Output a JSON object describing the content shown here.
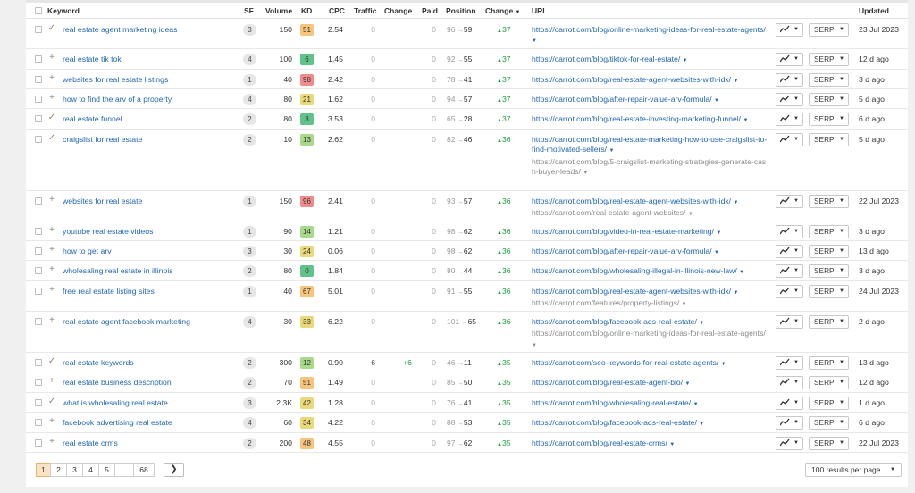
{
  "columns": {
    "keyword": "Keyword",
    "sf": "SF",
    "volume": "Volume",
    "kd": "KD",
    "cpc": "CPC",
    "traffic": "Traffic",
    "change": "Change",
    "paid": "Paid",
    "position": "Position",
    "position_change": "Change",
    "url": "URL",
    "updated": "Updated"
  },
  "sort_indicator": "▼",
  "dropdown_glyph": "▼",
  "up_glyph": "▲",
  "arrow_glyph": "→",
  "chart_button_icon": "chart-line-icon",
  "serp_label": "SERP",
  "kd_colors": {
    "very_hard": "#f08c8c",
    "hard": "#f6c47a",
    "medium": "#e9d97a",
    "easy": "#a9d98b",
    "very_easy": "#5fc38a"
  },
  "rows": [
    {
      "icon": "check",
      "keyword": "real estate agent marketing ideas",
      "sf": "3",
      "volume": "150",
      "kd": "51",
      "kd_level": "hard",
      "cpc": "2.54",
      "traffic": "0",
      "traffic_change": "",
      "paid": "0",
      "pos_from": "96",
      "pos_to": "59",
      "change": "37",
      "urls": [
        {
          "text": "https://carrot.com/blog/online-marketing-ideas-for-real-estate-agents/",
          "struck": false
        }
      ],
      "updated": "23 Jul 2023"
    },
    {
      "icon": "plus",
      "keyword": "real estate tik tok",
      "sf": "4",
      "volume": "100",
      "kd": "6",
      "kd_level": "very_easy",
      "cpc": "1.45",
      "traffic": "0",
      "traffic_change": "",
      "paid": "0",
      "pos_from": "92",
      "pos_to": "55",
      "change": "37",
      "urls": [
        {
          "text": "https://carrot.com/blog/tiktok-for-real-estate/",
          "struck": false
        }
      ],
      "updated": "12 d ago"
    },
    {
      "icon": "plus",
      "keyword": "websites for real estate listings",
      "sf": "1",
      "volume": "40",
      "kd": "98",
      "kd_level": "very_hard",
      "cpc": "2.42",
      "traffic": "0",
      "traffic_change": "",
      "paid": "0",
      "pos_from": "78",
      "pos_to": "41",
      "change": "37",
      "urls": [
        {
          "text": "https://carrot.com/blog/real-estate-agent-websites-with-idx/",
          "struck": false
        }
      ],
      "updated": "3 d ago"
    },
    {
      "icon": "plus",
      "keyword": "how to find the arv of a property",
      "sf": "4",
      "volume": "80",
      "kd": "21",
      "kd_level": "medium",
      "cpc": "1.62",
      "traffic": "0",
      "traffic_change": "",
      "paid": "0",
      "pos_from": "94",
      "pos_to": "57",
      "change": "37",
      "urls": [
        {
          "text": "https://carrot.com/blog/after-repair-value-arv-formula/",
          "struck": false
        }
      ],
      "updated": "5 d ago"
    },
    {
      "icon": "check",
      "keyword": "real estate funnel",
      "sf": "2",
      "volume": "80",
      "kd": "3",
      "kd_level": "very_easy",
      "cpc": "3.53",
      "traffic": "0",
      "traffic_change": "",
      "paid": "0",
      "pos_from": "65",
      "pos_to": "28",
      "change": "37",
      "urls": [
        {
          "text": "https://carrot.com/blog/real-estate-investing-marketing-funnel/",
          "struck": false
        }
      ],
      "updated": "6 d ago"
    },
    {
      "icon": "check",
      "keyword": "craigslist for real estate",
      "sf": "2",
      "volume": "10",
      "kd": "13",
      "kd_level": "easy",
      "cpc": "2.62",
      "traffic": "0",
      "traffic_change": "",
      "paid": "0",
      "pos_from": "82",
      "pos_to": "46",
      "change": "36",
      "urls": [
        {
          "text": "https://carrot.com/blog/real-estate-marketing-how-to-use-craigslist-to-find-motivated-sellers/",
          "struck": false
        },
        {
          "text": "https://carrot.com/blog/5-craigslist-marketing-strategies-generate-cash-buyer-leads/",
          "struck": true
        }
      ],
      "updated": "5 d ago"
    },
    {
      "icon": "plus",
      "keyword": "websites for real estate",
      "sf": "1",
      "volume": "150",
      "kd": "96",
      "kd_level": "very_hard",
      "cpc": "2.41",
      "traffic": "0",
      "traffic_change": "",
      "paid": "0",
      "pos_from": "93",
      "pos_to": "57",
      "change": "36",
      "urls": [
        {
          "text": "https://carrot.com/blog/real-estate-agent-websites-with-idx/",
          "struck": false
        },
        {
          "text": "https://carrot.com/real-estate-agent-websites/",
          "struck": true
        }
      ],
      "updated": "22 Jul 2023"
    },
    {
      "icon": "plus",
      "keyword": "youtube real estate videos",
      "sf": "1",
      "volume": "90",
      "kd": "14",
      "kd_level": "easy",
      "cpc": "1.21",
      "traffic": "0",
      "traffic_change": "",
      "paid": "0",
      "pos_from": "98",
      "pos_to": "62",
      "change": "36",
      "urls": [
        {
          "text": "https://carrot.com/blog/video-in-real-estate-marketing/",
          "struck": false
        }
      ],
      "updated": "3 d ago"
    },
    {
      "icon": "plus",
      "keyword": "how to get arv",
      "sf": "3",
      "volume": "30",
      "kd": "24",
      "kd_level": "medium",
      "cpc": "0.06",
      "traffic": "0",
      "traffic_change": "",
      "paid": "0",
      "pos_from": "98",
      "pos_to": "62",
      "change": "36",
      "urls": [
        {
          "text": "https://carrot.com/blog/after-repair-value-arv-formula/",
          "struck": false
        }
      ],
      "updated": "13 d ago"
    },
    {
      "icon": "plus",
      "keyword": "wholesaling real estate in illinois",
      "sf": "2",
      "volume": "80",
      "kd": "0",
      "kd_level": "very_easy",
      "cpc": "1.84",
      "traffic": "0",
      "traffic_change": "",
      "paid": "0",
      "pos_from": "80",
      "pos_to": "44",
      "change": "36",
      "urls": [
        {
          "text": "https://carrot.com/blog/wholesaling-illegal-in-illinois-new-law/",
          "struck": false
        }
      ],
      "updated": "3 d ago"
    },
    {
      "icon": "plus",
      "keyword": "free real estate listing sites",
      "sf": "1",
      "volume": "40",
      "kd": "67",
      "kd_level": "hard",
      "cpc": "5.01",
      "traffic": "0",
      "traffic_change": "",
      "paid": "0",
      "pos_from": "91",
      "pos_to": "55",
      "change": "36",
      "urls": [
        {
          "text": "https://carrot.com/blog/real-estate-agent-websites-with-idx/",
          "struck": false
        },
        {
          "text": "https://carrot.com/features/property-listings/",
          "struck": true
        }
      ],
      "updated": "24 Jul 2023"
    },
    {
      "icon": "plus",
      "keyword": "real estate agent facebook marketing",
      "sf": "4",
      "volume": "30",
      "kd": "33",
      "kd_level": "medium",
      "cpc": "6.22",
      "traffic": "0",
      "traffic_change": "",
      "paid": "0",
      "pos_from": "101",
      "pos_to": "65",
      "change": "36",
      "urls": [
        {
          "text": "https://carrot.com/blog/facebook-ads-real-estate/",
          "struck": false
        },
        {
          "text": "https://carrot.com/blog/online-marketing-ideas-for-real-estate-agents/",
          "struck": true
        }
      ],
      "updated": "2 d ago"
    },
    {
      "icon": "check",
      "keyword": "real estate keywords",
      "sf": "2",
      "volume": "300",
      "kd": "12",
      "kd_level": "easy",
      "cpc": "0.90",
      "traffic": "6",
      "traffic_change": "+6",
      "paid": "0",
      "pos_from": "46",
      "pos_to": "11",
      "change": "35",
      "urls": [
        {
          "text": "https://carrot.com/seo-keywords-for-real-estate-agents/",
          "struck": false
        }
      ],
      "updated": "13 d ago"
    },
    {
      "icon": "plus",
      "keyword": "real estate business description",
      "sf": "2",
      "volume": "70",
      "kd": "51",
      "kd_level": "hard",
      "cpc": "1.49",
      "traffic": "0",
      "traffic_change": "",
      "paid": "0",
      "pos_from": "85",
      "pos_to": "50",
      "change": "35",
      "urls": [
        {
          "text": "https://carrot.com/blog/real-estate-agent-bio/",
          "struck": false
        }
      ],
      "updated": "12 d ago"
    },
    {
      "icon": "check",
      "keyword": "what is wholesaling real estate",
      "sf": "3",
      "volume": "2.3K",
      "kd": "42",
      "kd_level": "medium",
      "cpc": "1.28",
      "traffic": "0",
      "traffic_change": "",
      "paid": "0",
      "pos_from": "76",
      "pos_to": "41",
      "change": "35",
      "urls": [
        {
          "text": "https://carrot.com/blog/wholesaling-real-estate/",
          "struck": false
        }
      ],
      "updated": "1 d ago"
    },
    {
      "icon": "plus",
      "keyword": "facebook advertising real estate",
      "sf": "4",
      "volume": "60",
      "kd": "34",
      "kd_level": "medium",
      "cpc": "4.22",
      "traffic": "0",
      "traffic_change": "",
      "paid": "0",
      "pos_from": "88",
      "pos_to": "53",
      "change": "35",
      "urls": [
        {
          "text": "https://carrot.com/blog/facebook-ads-real-estate/",
          "struck": false
        }
      ],
      "updated": "6 d ago"
    },
    {
      "icon": "plus",
      "keyword": "real estate crms",
      "sf": "2",
      "volume": "200",
      "kd": "48",
      "kd_level": "hard",
      "cpc": "4.55",
      "traffic": "0",
      "traffic_change": "",
      "paid": "0",
      "pos_from": "97",
      "pos_to": "62",
      "change": "35",
      "urls": [
        {
          "text": "https://carrot.com/blog/real-estate-crms/",
          "struck": false
        }
      ],
      "updated": "22 Jul 2023"
    }
  ],
  "pagination": {
    "pages": [
      "1",
      "2",
      "3",
      "4",
      "5",
      "...",
      "68"
    ],
    "current": "1",
    "next_glyph": "❯"
  },
  "per_page": {
    "selected": "100 results per page"
  }
}
